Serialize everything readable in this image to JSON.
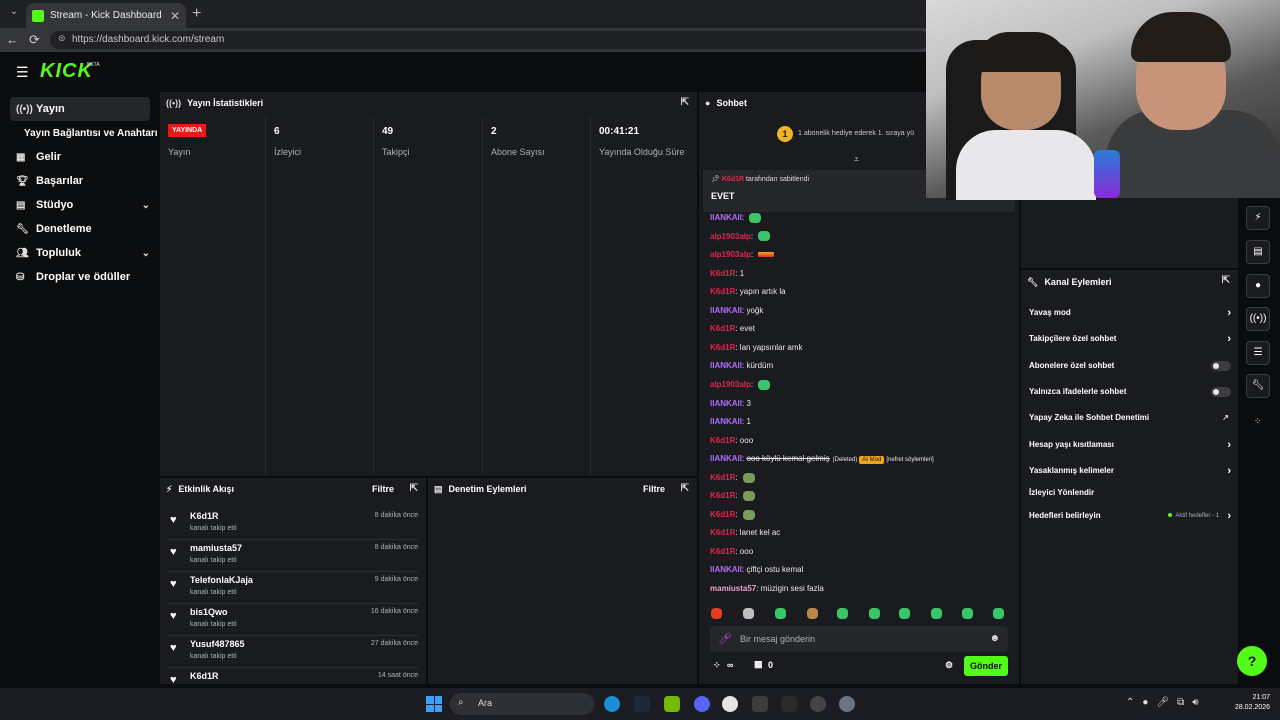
{
  "browser": {
    "tab_title": "Stream - Kick Dashboard",
    "url": "https://dashboard.kick.com/stream"
  },
  "header": {
    "logo": "KICK",
    "beta": "BETA"
  },
  "sidebar": {
    "items": [
      {
        "label": "Yayın",
        "icon": "broadcast-icon"
      },
      {
        "label": "Yayın Bağlantısı ve Anahtarı",
        "icon": ""
      },
      {
        "label": "Gelir",
        "icon": "revenue-icon"
      },
      {
        "label": "Başarılar",
        "icon": "trophy-icon"
      },
      {
        "label": "Stüdyo",
        "icon": "studio-icon"
      },
      {
        "label": "Denetleme",
        "icon": "wrench-icon"
      },
      {
        "label": "Topluluk",
        "icon": "community-icon"
      },
      {
        "label": "Droplar ve ödüller",
        "icon": "drops-icon"
      }
    ]
  },
  "stats": {
    "title": "Yayın İstatistikleri",
    "live_badge": "YAYINDA",
    "items": [
      {
        "value": "",
        "label": "Yayın"
      },
      {
        "value": "6",
        "label": "İzleyici"
      },
      {
        "value": "49",
        "label": "Takipçi"
      },
      {
        "value": "2",
        "label": "Abone Sayısı"
      },
      {
        "value": "00:41:21",
        "label": "Yayında Olduğu Süre"
      }
    ]
  },
  "activity": {
    "title": "Etkinlik Akışı",
    "filter": "Filtre",
    "items": [
      {
        "user": "K6d1R",
        "action": "kanalı takip etti",
        "time": "8 dakika önce"
      },
      {
        "user": "mamiusta57",
        "action": "kanalı takip etti",
        "time": "8 dakika önce"
      },
      {
        "user": "TelefonlaKJaja",
        "action": "kanalı takip etti",
        "time": "9 dakika önce"
      },
      {
        "user": "bis1Qwo",
        "action": "kanalı takip etti",
        "time": "16 dakika önce"
      },
      {
        "user": "Yusuf487865",
        "action": "kanalı takip etti",
        "time": "27 dakika önce"
      },
      {
        "user": "K6d1R",
        "action": "",
        "time": "14 saat önce"
      }
    ]
  },
  "moderation": {
    "title": "Denetim Eylemleri",
    "filter": "Filtre"
  },
  "chat": {
    "title": "Sohbet",
    "gift_count": "1",
    "gift_text": "1 abonelik hediye ederek 1. sıraya yü",
    "pinned_by_user": "K6d1R",
    "pinned_by_text": "tarafından sabitlendi",
    "pinned_message": "EVET",
    "messages": [
      {
        "user": "llANKAll",
        "text": "",
        "color": "#b26bff",
        "emote": "green"
      },
      {
        "user": "alp1903alp",
        "text": "",
        "color": "#e2264d",
        "emote": "green"
      },
      {
        "user": "alp1903alp",
        "text": "",
        "color": "#e2264d",
        "emote": "fire"
      },
      {
        "user": "K6d1R",
        "text": "1",
        "color": "#e2264d",
        "emote": ""
      },
      {
        "user": "K6d1R",
        "text": "yapın artık la",
        "color": "#e2264d",
        "emote": ""
      },
      {
        "user": "llANKAll",
        "text": "yoğk",
        "color": "#b26bff",
        "emote": ""
      },
      {
        "user": "K6d1R",
        "text": "evet",
        "color": "#e2264d",
        "emote": ""
      },
      {
        "user": "K6d1R",
        "text": "lan yapsınlar amk",
        "color": "#e2264d",
        "emote": ""
      },
      {
        "user": "llANKAll",
        "text": "kürdüm",
        "color": "#b26bff",
        "emote": ""
      },
      {
        "user": "alp1903alp",
        "text": "",
        "color": "#e2264d",
        "emote": "green"
      },
      {
        "user": "llANKAll",
        "text": "3",
        "color": "#b26bff",
        "emote": ""
      },
      {
        "user": "llANKAll",
        "text": "1",
        "color": "#b26bff",
        "emote": ""
      },
      {
        "user": "K6d1R",
        "text": "ooo",
        "color": "#e2264d",
        "emote": ""
      },
      {
        "user": "llANKAll",
        "text": "ooo köylü kemal gelmiş",
        "color": "#b26bff",
        "emote": "",
        "deleted": "(Deleted)",
        "mod": "AI Mod",
        "reason": "[nefret söylemleri]"
      },
      {
        "user": "K6d1R",
        "text": "",
        "color": "#e2264d",
        "emote": "turt"
      },
      {
        "user": "K6d1R",
        "text": "",
        "color": "#e2264d",
        "emote": "turt"
      },
      {
        "user": "K6d1R",
        "text": "",
        "color": "#e2264d",
        "emote": "turt"
      },
      {
        "user": "K6d1R",
        "text": "lanet kel ac",
        "color": "#e2264d",
        "emote": ""
      },
      {
        "user": "K6d1R",
        "text": "ooo",
        "color": "#e2264d",
        "emote": ""
      },
      {
        "user": "llANKAll",
        "text": "çiftçi ostu kemal",
        "color": "#b26bff",
        "emote": ""
      },
      {
        "user": "mamiusta57",
        "text": "müzigin sesi fazla",
        "color": "#f0a0c8",
        "emote": ""
      }
    ],
    "input_placeholder": "Bir mesaj gönderin",
    "points": "∞",
    "gift_value": "0",
    "send_label": "Gönder"
  },
  "channel_actions": {
    "title": "Kanal Eylemleri",
    "rows": [
      {
        "label": "Yavaş mod",
        "control": "arrow"
      },
      {
        "label": "Takipçilere özel sohbet",
        "control": "arrow"
      },
      {
        "label": "Abonelere özel sohbet",
        "control": "toggle"
      },
      {
        "label": "Yalnızca ifadelerle sohbet",
        "control": "toggle"
      },
      {
        "label": "Yapay Zeka ile Sohbet Denetimi",
        "control": "chart"
      },
      {
        "label": "Hesap yaşı kısıtlaması",
        "control": "arrow"
      },
      {
        "label": "Yasaklanmış kelimeler",
        "control": "arrow"
      },
      {
        "label": "İzleyici Yönlendir",
        "control": "none"
      },
      {
        "label": "Hedefleri belirleyin",
        "control": "arrow",
        "extra": "Aktif hedefler - 1"
      }
    ]
  },
  "taskbar": {
    "search": "Ara",
    "time": "21:07",
    "date": "28.02.2026"
  },
  "colors": {
    "brand": "#53fc18",
    "live": "#e91916",
    "bg": "#0b0c0d",
    "panel": "#191b1f"
  }
}
